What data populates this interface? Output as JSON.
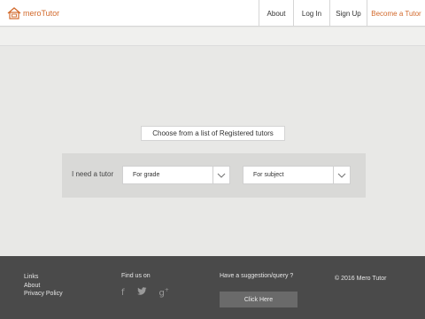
{
  "header": {
    "logo_text": "meroTutor",
    "nav": [
      "About",
      "Log In",
      "Sign Up",
      "Become a Tutor"
    ]
  },
  "main": {
    "choose_label": "Choose from a list of Registered tutors",
    "search": {
      "label": "I need a tutor",
      "grade_selected": "For grade",
      "subject_selected": "For subject"
    }
  },
  "footer": {
    "links": [
      "Links",
      "About",
      "Privacy Policy"
    ],
    "find_us": "Find us on",
    "social_icons": [
      "facebook-icon",
      "twitter-icon",
      "google-plus-icon"
    ],
    "suggestion": "Have a suggestion/query ?",
    "click_here": "Click Here",
    "copyright": "© 2016 Mero Tutor"
  },
  "colors": {
    "accent": "#d2692b",
    "footer_bg": "#4a4a4a",
    "page_bg": "#e8e8e6"
  }
}
